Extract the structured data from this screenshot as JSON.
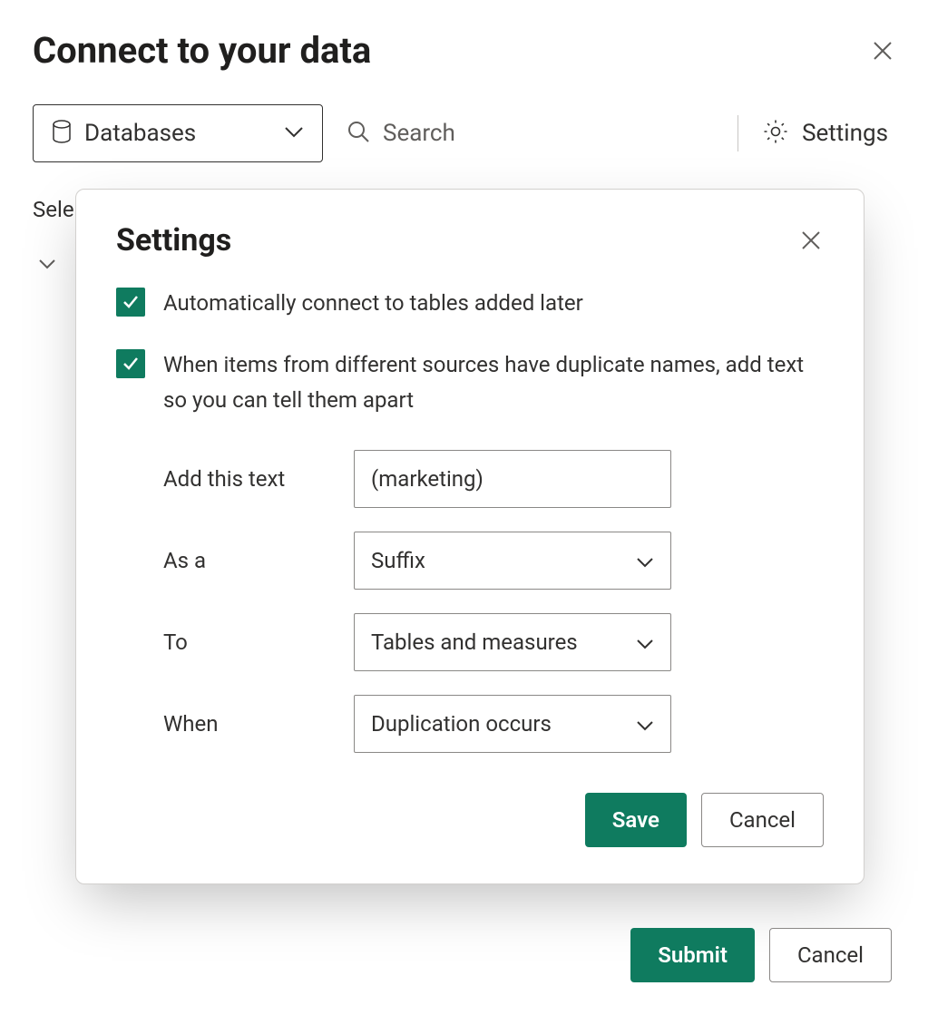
{
  "main": {
    "title": "Connect to your data",
    "dropdown_label": "Databases",
    "search_placeholder": "Search",
    "settings_label": "Settings",
    "body_select_label_partial": "Sele",
    "submit_label": "Submit",
    "cancel_label": "Cancel"
  },
  "modal": {
    "title": "Settings",
    "checkbox1_label": "Automatically connect to tables added later",
    "checkbox2_label": "When items from different sources have duplicate names, add text so you can tell them apart",
    "form": {
      "add_text_label": "Add this text",
      "add_text_value": "(marketing)",
      "as_a_label": "As a",
      "as_a_value": "Suffix",
      "to_label": "To",
      "to_value": "Tables and measures",
      "when_label": "When",
      "when_value": "Duplication occurs"
    },
    "save_label": "Save",
    "cancel_label": "Cancel"
  },
  "colors": {
    "accent": "#0f7b5f"
  }
}
